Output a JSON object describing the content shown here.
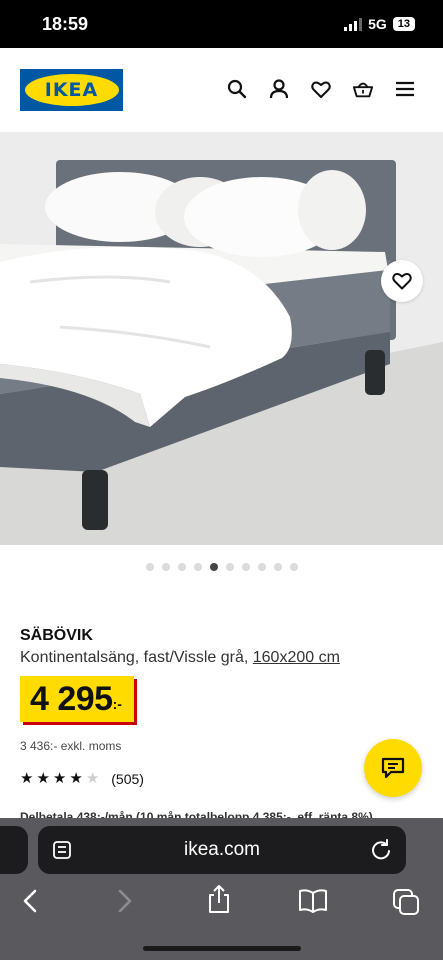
{
  "status_bar": {
    "time": "18:59",
    "network": "5G",
    "battery": "13"
  },
  "header": {
    "logo_text": "IKEA",
    "icons": [
      "search-icon",
      "profile-icon",
      "heart-icon",
      "basket-icon",
      "menu-icon"
    ]
  },
  "gallery": {
    "dot_count": 10,
    "active_index": 4
  },
  "product": {
    "name": "SÄBÖVIK",
    "description": "Kontinentalsäng, fast/Vissle grå,",
    "size": "160x200 cm",
    "price": "4 295",
    "price_suffix": ":-",
    "price_excl_vat": "3 436:- exkl. moms",
    "rating": 4,
    "rating_max": 5,
    "review_count": "(505)",
    "payment_info": "Delbetala 438:-/mån (10 mån totalbelopp 4 385:-, eff. ränta 8%)"
  },
  "browser": {
    "url": "ikea.com"
  },
  "colors": {
    "brand_blue": "#0058a3",
    "brand_yellow": "#ffdb00",
    "price_shadow": "#cc0008"
  }
}
